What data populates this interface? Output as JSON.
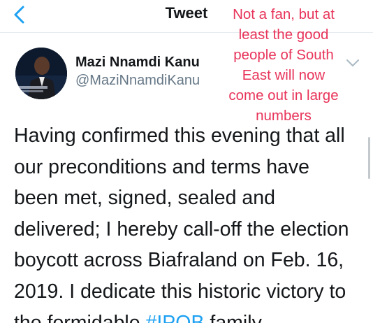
{
  "nav": {
    "title": "Tweet",
    "back_icon": "chevron-left-icon",
    "accent_color": "#1da1f2"
  },
  "author": {
    "name": "Mazi Nnamdi Kanu",
    "handle": "@MaziNnamdiKanu",
    "menu_icon": "chevron-down-icon"
  },
  "overlay": {
    "lines": [
      "Not a fan, but at",
      "least the good",
      "people of South",
      "East will now",
      "come out in large",
      "numbers"
    ],
    "color": "#e8345a"
  },
  "tweet": {
    "lines": [
      "Having confirmed this evening that all",
      "our preconditions and terms have",
      "been met, signed, sealed and",
      "delivered; I hereby call-off the election",
      "boycott across Biafraland on Feb. 16,",
      "2019. I dedicate this historic victory to"
    ],
    "last_line_prefix": "the formidable ",
    "hashtag": "#IPOB",
    "last_line_suffix": " family"
  }
}
